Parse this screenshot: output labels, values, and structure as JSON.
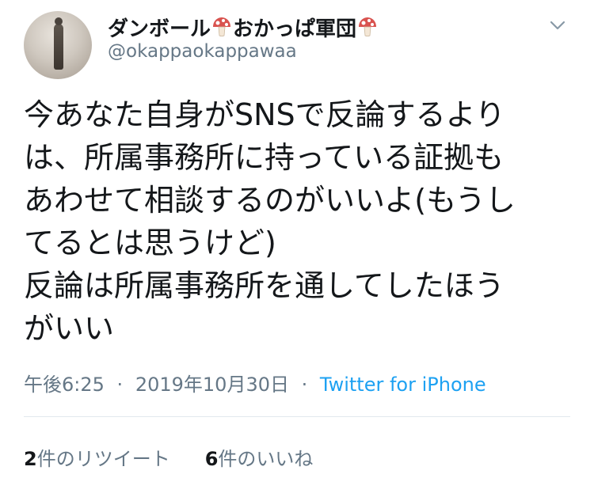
{
  "tweet": {
    "display_name_part1": "ダンボール",
    "display_name_part2": "おかっぱ軍団",
    "handle": "@okappaokappawaa",
    "text": "今あなた自身がSNSで反論するより\nは、所属事務所に持っている証拠も\nあわせて相談するのがいいよ(もうし\nてるとは思うけど)\n反論は所属事務所を通してしたほう\nがいい",
    "time": "午後6:25",
    "date": "2019年10月30日",
    "separator": "·",
    "source": "Twitter for iPhone"
  },
  "stats": {
    "retweets_count": "2",
    "retweets_label": "件のリツイート",
    "likes_count": "6",
    "likes_label": "件のいいね"
  },
  "icons": {
    "name_decoration": "mushroom-icon",
    "menu": "chevron-down-icon"
  },
  "colors": {
    "accent": "#1da1f2",
    "secondary_text": "#657786",
    "mushroom_cap": "#d9534f"
  }
}
